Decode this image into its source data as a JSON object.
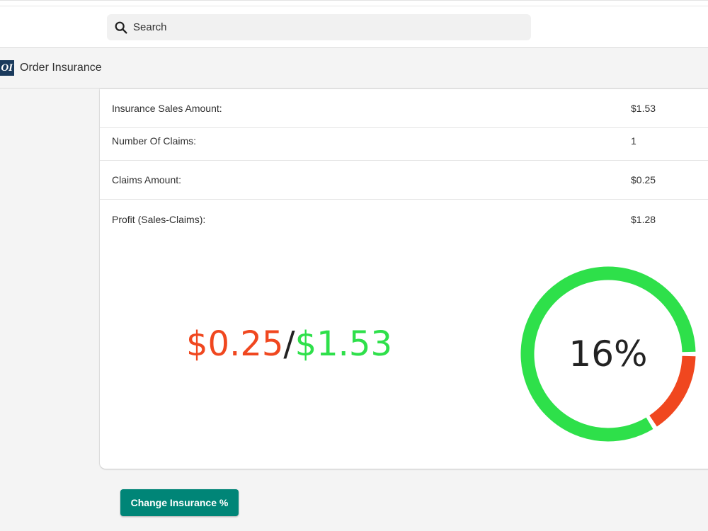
{
  "search": {
    "placeholder": "Search"
  },
  "app": {
    "logo_text": "OI",
    "title": "Order Insurance"
  },
  "stats": [
    {
      "label": "Insurance Sales Amount:",
      "value": "$1.53"
    },
    {
      "label": "Number Of Claims:",
      "value": "1"
    },
    {
      "label": "Claims Amount:",
      "value": "$0.25"
    },
    {
      "label": "Profit (Sales-Claims):",
      "value": "$1.28"
    }
  ],
  "ratio": {
    "claims": "$0.25",
    "slash": "/",
    "sales": "$1.53"
  },
  "gauge": {
    "label": "16%",
    "claims_fraction": 0.16,
    "claims_color": "#f0471f",
    "sales_color": "#2ee04a"
  },
  "actions": {
    "change_label": "Change Insurance %"
  },
  "colors": {
    "primary_button": "#008577",
    "brand_logo": "#1a3a5c"
  }
}
